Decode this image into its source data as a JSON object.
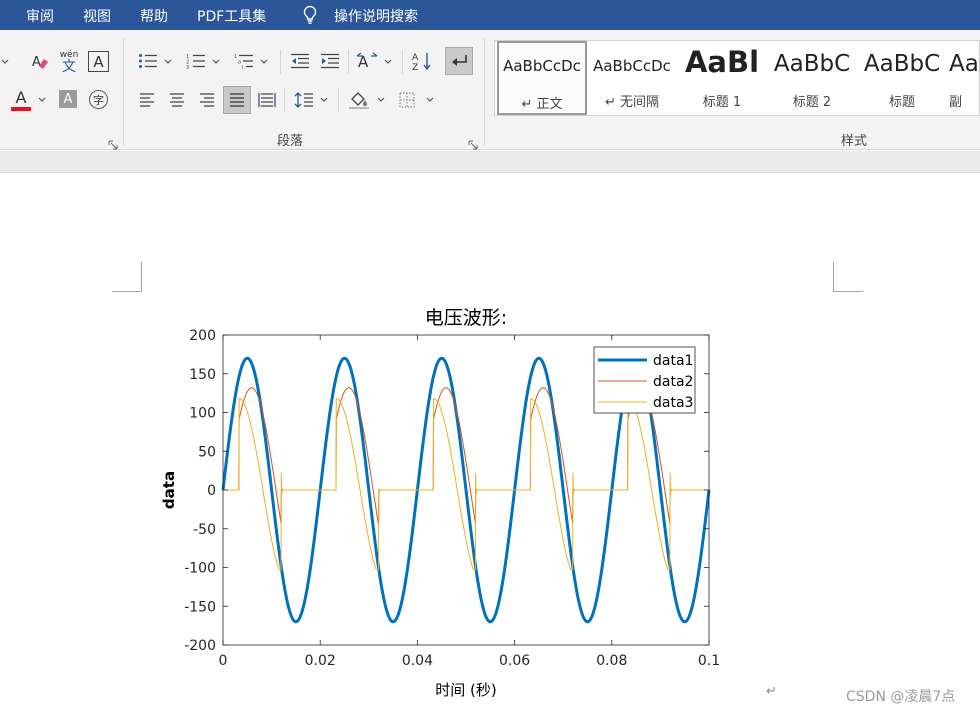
{
  "tabs": [
    {
      "label": "审阅"
    },
    {
      "label": "视图"
    },
    {
      "label": "帮助"
    },
    {
      "label": "PDF工具集"
    }
  ],
  "tell_me": "操作说明搜索",
  "ribbon": {
    "font_group": {
      "phonetic_top": "wén",
      "phonetic_bottom": "文",
      "border_char": "A",
      "font_color_char": "A",
      "shading_char": "A",
      "enclose_char": "字",
      "font_color": "#e81123"
    },
    "paragraph_group": {
      "label": "段落"
    },
    "styles_group": {
      "label": "样式",
      "items": [
        {
          "preview": "AaBbCcDc",
          "name": "↵ 正文"
        },
        {
          "preview": "AaBbCcDc",
          "name": "↵ 无间隔"
        },
        {
          "preview": "AaBl",
          "name": "标题 1"
        },
        {
          "preview": "AaBbC",
          "name": "标题 2"
        },
        {
          "preview": "AaBbC",
          "name": "标题"
        },
        {
          "preview": "Aa",
          "name": "副"
        }
      ]
    }
  },
  "document": {
    "paragraph_mark": "↵",
    "watermark": "CSDN @凌晨7点"
  },
  "colors": {
    "ribbon_accent": "#2b579a",
    "series1": "#0072bd",
    "series2": "#d95319",
    "series3": "#edb120"
  },
  "chart_data": {
    "type": "line",
    "title": "电压波形:",
    "xlabel": "时间 (秒)",
    "ylabel": "data",
    "xlim": [
      0,
      0.1
    ],
    "ylim": [
      -200,
      200
    ],
    "xticks": [
      0,
      0.02,
      0.04,
      0.06,
      0.08,
      0.1
    ],
    "xtick_labels": [
      "0",
      "0.02",
      "0.04",
      "0.06",
      "0.08",
      "0.1"
    ],
    "yticks": [
      -200,
      -150,
      -100,
      -50,
      0,
      50,
      100,
      150,
      200
    ],
    "ytick_labels": [
      "-200",
      "-150",
      "-100",
      "-50",
      "0",
      "50",
      "100",
      "150",
      "200"
    ],
    "legend_position": "top-right",
    "grid": false,
    "series": [
      {
        "name": "data1",
        "amplitude": 170,
        "frequency_hz": 50,
        "phase_start_s": 0.0,
        "x": [
          0,
          0.0025,
          0.005,
          0.0075,
          0.01,
          0.0125,
          0.015,
          0.0175,
          0.02
        ],
        "values": [
          0,
          120,
          170,
          120,
          0,
          -120,
          -170,
          -120,
          0
        ]
      },
      {
        "name": "data2",
        "peak": 132,
        "conduction_start_s": 0.0033,
        "conduction_end_s": 0.012,
        "x": [
          0,
          0.0033,
          0.0075,
          0.012,
          0.02
        ],
        "values": [
          0,
          0,
          132,
          0,
          0
        ]
      },
      {
        "name": "data3",
        "peak_positive": 118,
        "peak_negative": -103,
        "conduction_start_s": 0.0033,
        "conduction_end_s": 0.012,
        "x": [
          0,
          0.0033,
          0.0036,
          0.0078,
          0.0118,
          0.012,
          0.0125,
          0.02
        ],
        "values": [
          0,
          0,
          118,
          0,
          -103,
          22,
          0,
          0
        ]
      }
    ]
  }
}
